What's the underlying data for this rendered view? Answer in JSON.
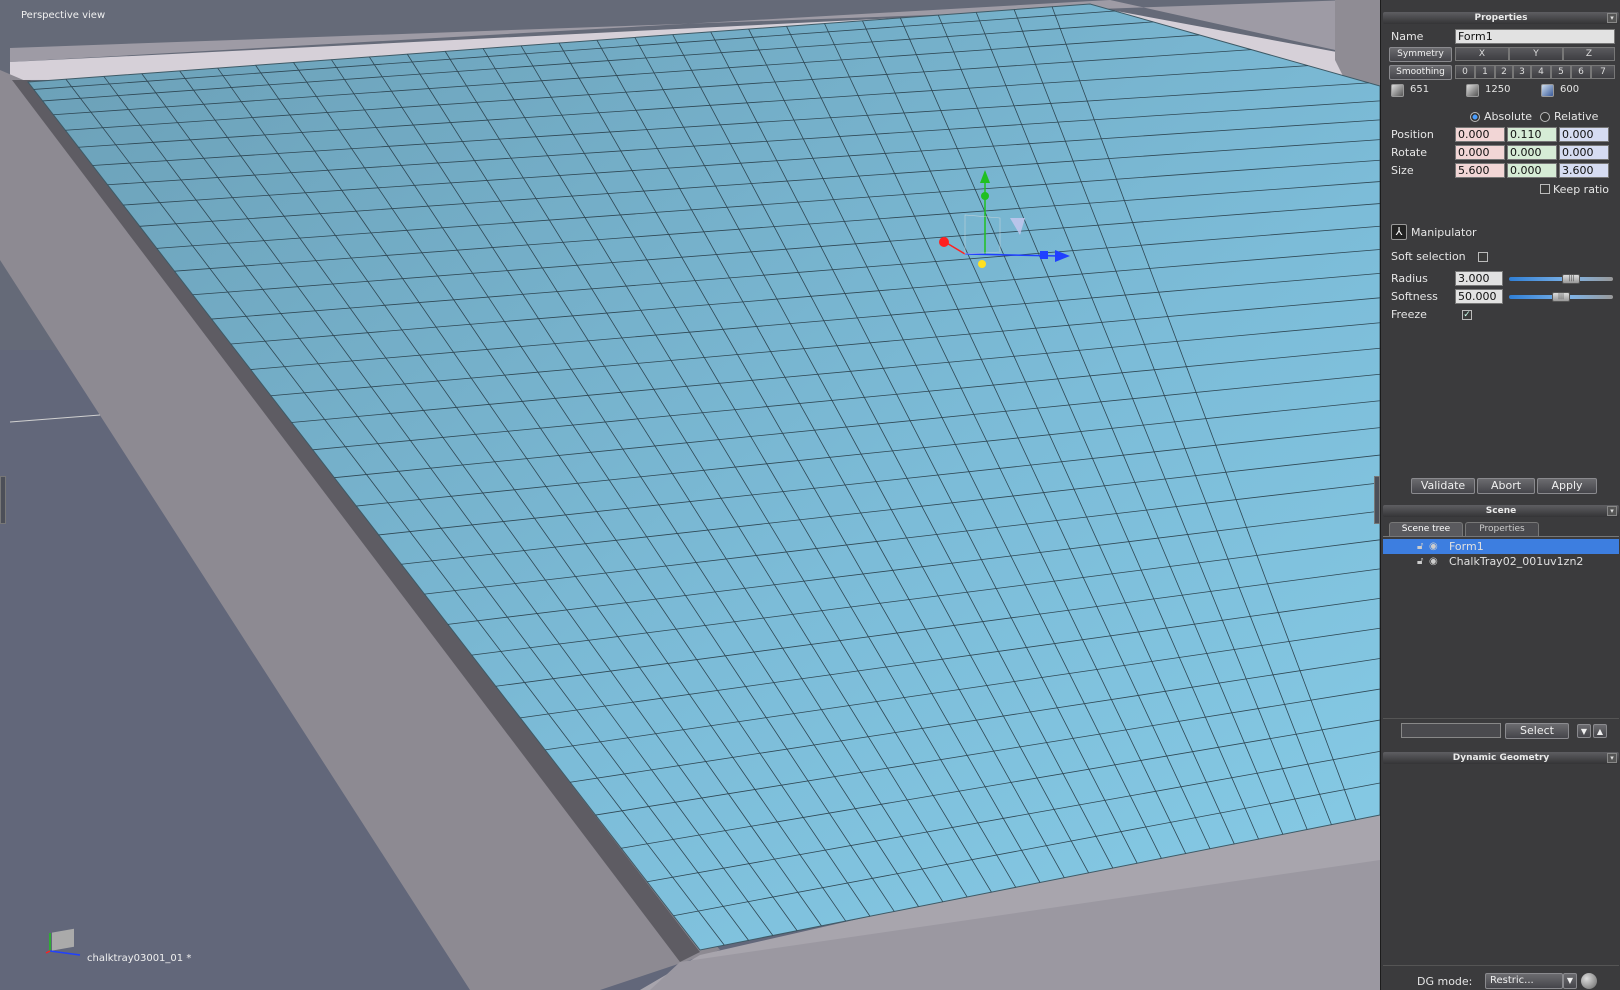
{
  "viewport": {
    "title": "Perspective view",
    "object_label": "chalktray03001_01 *"
  },
  "properties": {
    "panel_title": "Properties",
    "name_label": "Name",
    "name_value": "Form1",
    "symmetry_label": "Symmetry",
    "symmetry_axes": [
      "X",
      "Y",
      "Z"
    ],
    "smoothing_label": "Smoothing",
    "smoothing_levels": [
      "0",
      "1",
      "2",
      "3",
      "4",
      "5",
      "6",
      "7"
    ],
    "stats": [
      "651",
      "1250",
      "600"
    ],
    "absolute_label": "Absolute",
    "relative_label": "Relative",
    "position_label": "Position",
    "position": [
      "0.000",
      "0.110",
      "0.000"
    ],
    "rotate_label": "Rotate",
    "rotate": [
      "0.000",
      "0.000",
      "0.000"
    ],
    "size_label": "Size",
    "size": [
      "5.600",
      "0.000",
      "3.600"
    ],
    "keep_ratio_label": "Keep ratio",
    "manipulator_label": "Manipulator",
    "soft_selection_label": "Soft selection",
    "radius_label": "Radius",
    "radius_value": "3.000",
    "radius_level": 0.6,
    "softness_label": "Softness",
    "softness_value": "50.000",
    "softness_level": 0.5,
    "freeze_label": "Freeze",
    "freeze_check": "✓",
    "validate_label": "Validate",
    "abort_label": "Abort",
    "apply_label": "Apply"
  },
  "scene": {
    "panel_title": "Scene",
    "tabs": [
      "Scene tree",
      "Properties"
    ],
    "items": [
      "Form1",
      "ChalkTray02_001uv1zn2"
    ],
    "select_label": "Select"
  },
  "dynamic_geometry": {
    "panel_title": "Dynamic Geometry",
    "dg_mode_label": "DG mode:",
    "dg_mode_value": "Restric..."
  },
  "colors": {
    "grid_fill": "#7ab8d4",
    "frame": "#a9a8ae",
    "selection": "#3d7ee0",
    "x_axis": "#ff2020",
    "y_axis": "#20c020",
    "z_axis": "#2040ff"
  }
}
